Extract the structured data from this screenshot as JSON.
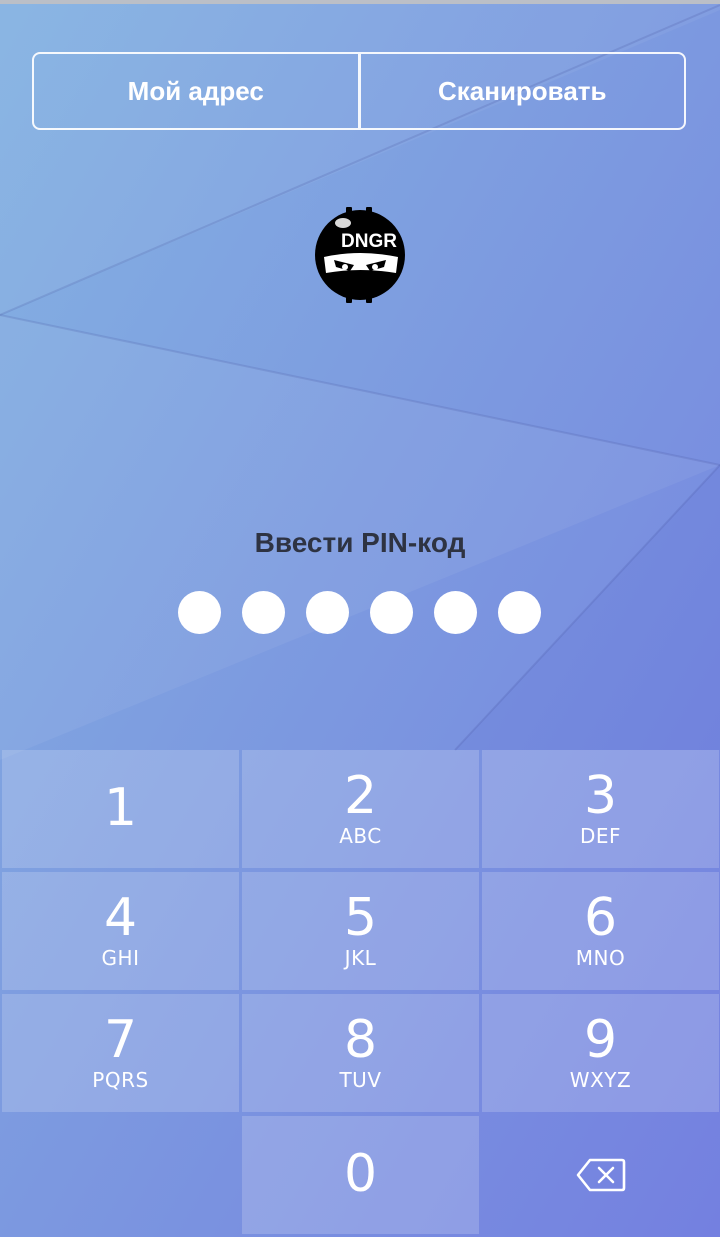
{
  "header": {
    "my_address_label": "Мой адрес",
    "scan_label": "Сканировать"
  },
  "logo": {
    "text": "DNGR"
  },
  "pin": {
    "title": "Ввести PIN-код",
    "length": 6,
    "entered": 0
  },
  "keypad": {
    "keys": [
      {
        "digit": "1",
        "letters": ""
      },
      {
        "digit": "2",
        "letters": "ABC"
      },
      {
        "digit": "3",
        "letters": "DEF"
      },
      {
        "digit": "4",
        "letters": "GHI"
      },
      {
        "digit": "5",
        "letters": "JKL"
      },
      {
        "digit": "6",
        "letters": "MNO"
      },
      {
        "digit": "7",
        "letters": "PQRS"
      },
      {
        "digit": "8",
        "letters": "TUV"
      },
      {
        "digit": "9",
        "letters": "WXYZ"
      },
      {
        "digit": "0",
        "letters": ""
      }
    ],
    "backspace_icon": "backspace-icon"
  },
  "colors": {
    "gradient_start": "#84b2e2",
    "gradient_end": "#7480e0",
    "pin_title": "#2e3342",
    "key_text": "#ffffff"
  }
}
